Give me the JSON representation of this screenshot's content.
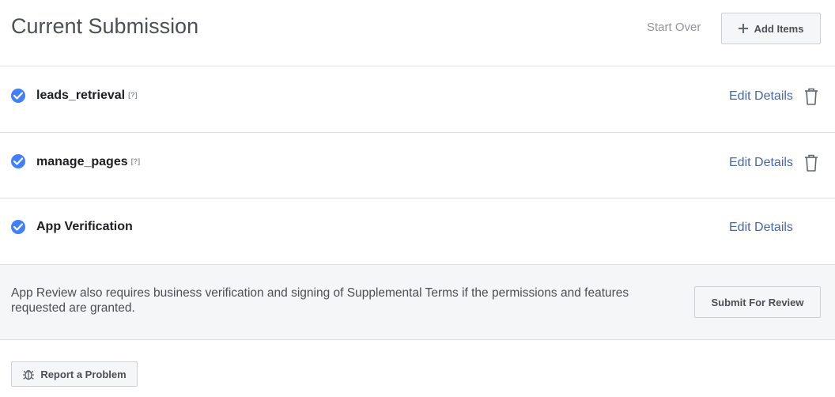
{
  "header": {
    "title": "Current Submission",
    "start_over": "Start Over",
    "add_items": "Add Items"
  },
  "items": [
    {
      "name": "leads_retrieval",
      "help": "[?]",
      "edit": "Edit Details",
      "deletable": true
    },
    {
      "name": "manage_pages",
      "help": "[?]",
      "edit": "Edit Details",
      "deletable": true
    },
    {
      "name": "App Verification",
      "help": "",
      "edit": "Edit Details",
      "deletable": false
    }
  ],
  "notice": {
    "text": "App Review also requires business verification and signing of Supplemental Terms if the permissions and features requested are granted.",
    "submit_label": "Submit For Review"
  },
  "footer": {
    "report_label": "Report a Problem"
  },
  "colors": {
    "accent": "#4080ff",
    "link": "#4267b2",
    "panel": "#f5f6f7"
  },
  "icons": [
    "plus-icon",
    "check-circle-icon",
    "trash-icon",
    "bug-icon"
  ]
}
